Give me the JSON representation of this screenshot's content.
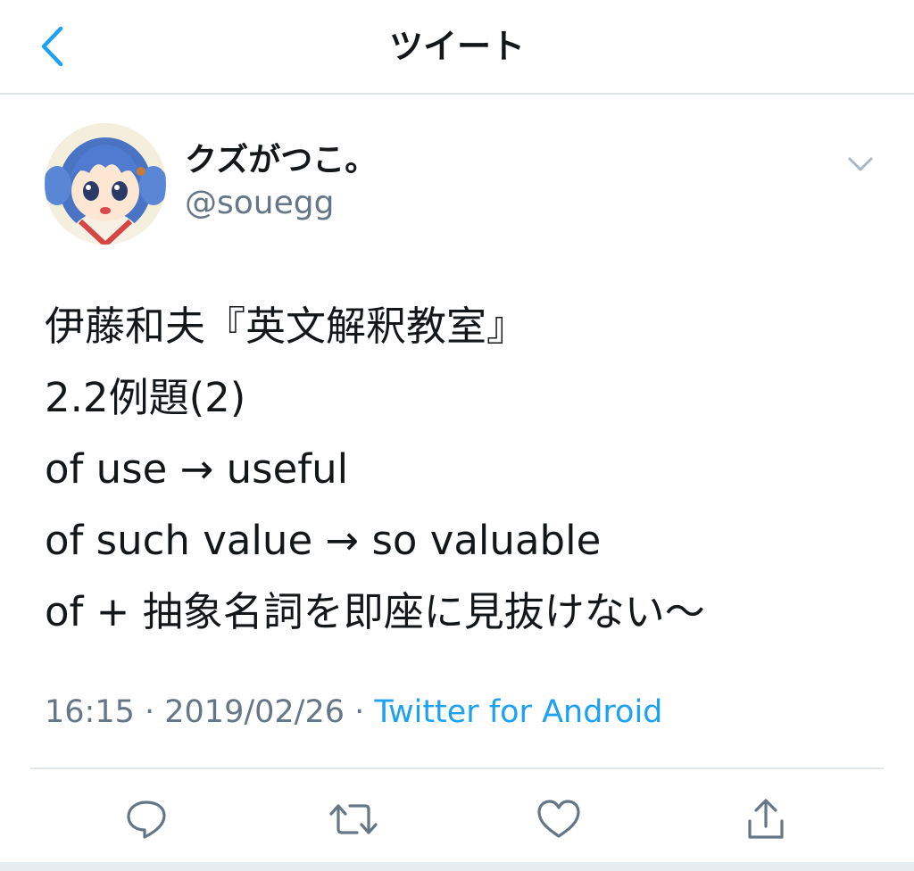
{
  "header": {
    "back_icon": "chevron-left-icon",
    "title": "ツイート"
  },
  "tweet": {
    "author": {
      "display_name": "クズがつこ。",
      "handle": "@souegg"
    },
    "text_lines": [
      "伊藤和夫『英文解釈教室』",
      "2.2例題(2)",
      "of use → useful",
      "of such value → so valuable",
      "of + 抽象名詞を即座に見抜けない〜"
    ],
    "time": "16:15",
    "separator": " · ",
    "date": "2019/02/26",
    "source": "Twitter for Android"
  },
  "actions": [
    {
      "name": "reply",
      "icon": "speech-bubble-icon"
    },
    {
      "name": "retweet",
      "icon": "retweet-icon"
    },
    {
      "name": "like",
      "icon": "heart-icon"
    },
    {
      "name": "share",
      "icon": "share-icon"
    }
  ],
  "colors": {
    "accent": "#1da1f2",
    "text": "#14171a",
    "secondary": "#657786",
    "icon": "#657786",
    "divider": "#e1e6ea"
  }
}
